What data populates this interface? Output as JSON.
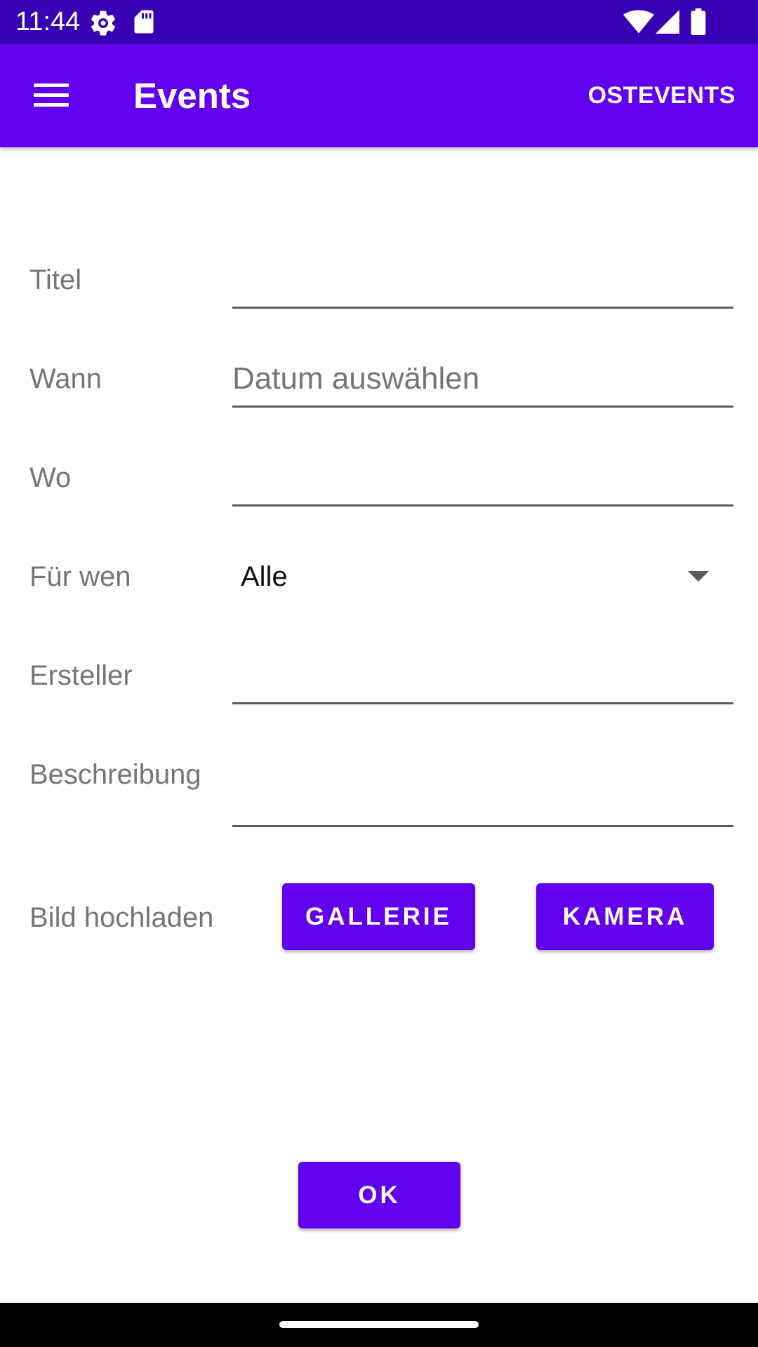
{
  "status_bar": {
    "time": "11:44",
    "icons": [
      "settings-gear-icon",
      "sd-card-icon",
      "wifi-icon",
      "cell-signal-icon",
      "battery-icon"
    ]
  },
  "app_bar": {
    "title": "Events",
    "action_label": "OSTEVENTS",
    "menu_icon": "hamburger-menu-icon",
    "background_color": "#6200ee"
  },
  "form": {
    "title_label": "Titel",
    "title_value": "",
    "when_label": "Wann",
    "when_placeholder": "Datum auswählen",
    "where_label": "Wo",
    "where_value": "",
    "for_whom_label": "Für wen",
    "for_whom_selected": "Alle",
    "creator_label": "Ersteller",
    "creator_value": "",
    "description_label": "Beschreibung",
    "description_value": "",
    "image_upload_label": "Bild hochladen",
    "gallery_button": "GALLERIE",
    "camera_button": "KAMERA",
    "ok_button": "OK"
  },
  "colors": {
    "status_bar": "#3700b3",
    "primary": "#6200ee",
    "label_text": "#757575"
  }
}
